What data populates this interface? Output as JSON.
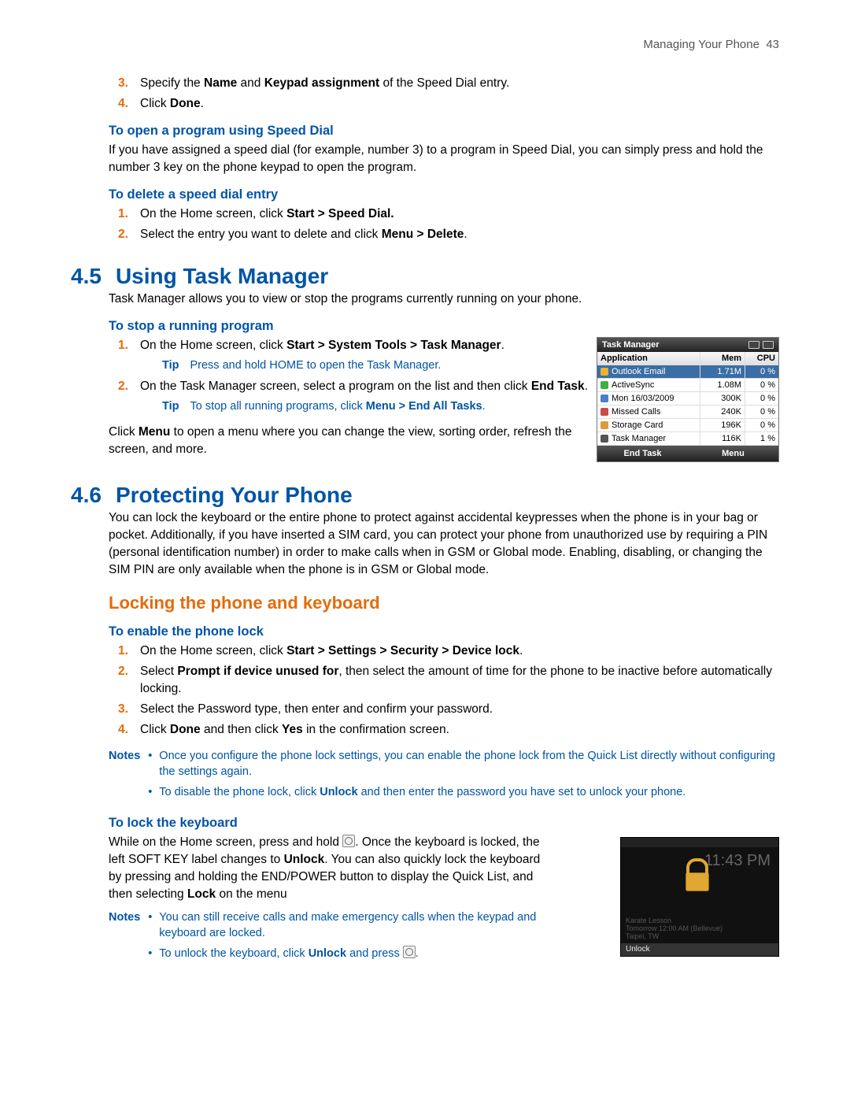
{
  "header": {
    "running": "Managing Your Phone",
    "page": "43"
  },
  "intro_steps": {
    "s3a": "Specify the ",
    "s3b": "Name",
    "s3c": " and ",
    "s3d": "Keypad assignment",
    "s3e": " of the Speed Dial entry.",
    "s4a": "Click ",
    "s4b": "Done",
    "s4c": "."
  },
  "open_sd": {
    "title": "To open a program using Speed Dial",
    "body": "If you have assigned a speed dial (for example, number 3) to a program in Speed Dial, you can simply press and hold the number 3 key on the phone keypad to open the program."
  },
  "delete_sd": {
    "title": "To delete a speed dial entry",
    "s1a": "On the Home screen, click ",
    "s1b": "Start > Speed Dial.",
    "s2a": "Select the entry you want to delete and click ",
    "s2b": "Menu > Delete",
    "s2c": "."
  },
  "sec45": {
    "num": "4.5",
    "title": "Using Task Manager",
    "body": "Task Manager allows you to view or stop the programs currently running on your phone."
  },
  "stop_prog": {
    "title": "To stop a running program",
    "s1a": "On the Home screen, click ",
    "s1b": "Start > System Tools > Task Manager",
    "s1c": ".",
    "tip1_label": "Tip",
    "tip1": "Press and hold HOME to open the Task Manager.",
    "s2a": "On the Task Manager screen, select a program on the list and then click ",
    "s2b": "End Task",
    "s2c": ".",
    "tip2_label": "Tip",
    "tip2a": "To stop all running programs, click ",
    "tip2b": "Menu > End All Tasks",
    "tip2c": ".",
    "after_a": "Click ",
    "after_b": "Menu",
    "after_c": " to open a menu where you can change the view, sorting order, refresh the screen, and more."
  },
  "taskmgr": {
    "title": "Task Manager",
    "columns": {
      "app": "Application",
      "mem": "Mem",
      "cpu": "CPU"
    },
    "rows": [
      {
        "app": "Outlook Email",
        "mem": "1.71M",
        "cpu": "0 %"
      },
      {
        "app": "ActiveSync",
        "mem": "1.08M",
        "cpu": "0 %"
      },
      {
        "app": "Mon 16/03/2009",
        "mem": "300K",
        "cpu": "0 %"
      },
      {
        "app": "Missed Calls",
        "mem": "240K",
        "cpu": "0 %"
      },
      {
        "app": "Storage Card",
        "mem": "196K",
        "cpu": "0 %"
      },
      {
        "app": "Task Manager",
        "mem": "116K",
        "cpu": "1 %"
      }
    ],
    "footer": {
      "left": "End Task",
      "right": "Menu"
    }
  },
  "sec46": {
    "num": "4.6",
    "title": "Protecting Your Phone",
    "body": "You can lock the keyboard or the entire phone to protect against accidental keypresses when the phone is in your bag or pocket. Additionally, if you have inserted a SIM card, you can protect your phone from unauthorized use by requiring a PIN (personal identification number) in order to make calls when in GSM or Global mode. Enabling, disabling, or changing the SIM PIN are only available when the phone is in GSM or Global mode."
  },
  "lock_sub": {
    "title": "Locking the phone and keyboard"
  },
  "enable_lock": {
    "title": "To enable the phone lock",
    "s1a": "On the Home screen, click ",
    "s1b": "Start > Settings > Security > Device lock",
    "s1c": ".",
    "s2a": "Select ",
    "s2b": "Prompt if device unused for",
    "s2c": ", then select the amount of time for the phone to be inactive before automatically locking.",
    "s3": "Select the Password type, then enter and confirm your password.",
    "s4a": "Click ",
    "s4b": "Done",
    "s4c": " and then click ",
    "s4d": "Yes",
    "s4e": " in the confirmation screen.",
    "notes_label": "Notes",
    "n1": "Once you configure the phone lock settings, you can enable the phone lock from the Quick List directly without configuring the settings again.",
    "n2a": "To disable the phone lock, click ",
    "n2b": "Unlock",
    "n2c": " and then enter the password you have set to unlock your phone."
  },
  "lock_kb": {
    "title": "To lock the keyboard",
    "b1": "While on the Home screen, press and hold ",
    "b2": ". Once the keyboard is locked, the left SOFT KEY label changes to ",
    "b2b": "Unlock",
    "b3": ". You can also quickly lock the keyboard by pressing and holding the END/POWER button to display the Quick List, and then selecting ",
    "b3b": "Lock",
    "b4": " on the menu",
    "notes_label": "Notes",
    "n1": "You can still receive calls and make emergency calls when the keypad and keyboard are locked.",
    "n2a": "To unlock the keyboard, click ",
    "n2b": "Unlock",
    "n2c": " and press ",
    "n2d": "."
  },
  "lockscr": {
    "time": "11:43 PM",
    "cal": "Karate Lesson\nTomorrow  12:00 AM (Bellevue)",
    "loc": "Taipei, TW",
    "soft": "Unlock"
  }
}
